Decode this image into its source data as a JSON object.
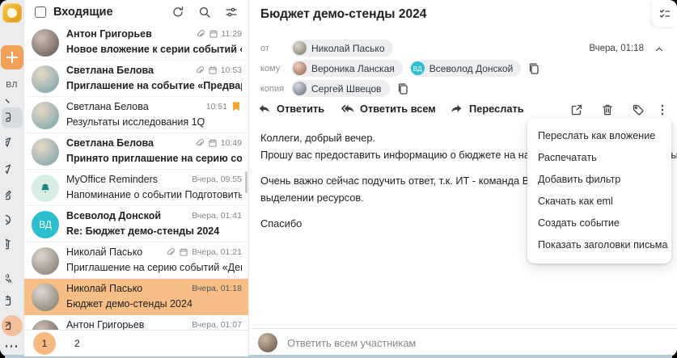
{
  "colors": {
    "accent_orange": "#f2a159",
    "selection_orange": "#f6be85",
    "flag_orange": "#f5a22d",
    "avatar_teal": "#2bbfce",
    "pagination_orange": "#f5b87e"
  },
  "rail": {
    "logo_icon": "myoffice-mail-logo",
    "profile_initials": "ВЛ",
    "folder_icons": [
      "inbox",
      "sent",
      "outbox",
      "drafts",
      "spam",
      "trash"
    ],
    "app_icons": [
      "contacts",
      "calendar",
      "mail",
      "more"
    ]
  },
  "list": {
    "header": {
      "title": "Входящие",
      "icons": [
        "refresh",
        "search",
        "filter"
      ]
    },
    "rows": [
      {
        "sender": "Антон Григорьев",
        "subject": "Новое вложение к серии событий «Аналити...",
        "time": "11:29",
        "unread": true,
        "attach": true
      },
      {
        "sender": "Светлана Белова",
        "subject": "Приглашение на событие «Предварительно...",
        "time": "10:53",
        "unread": true,
        "attach": true
      },
      {
        "sender": "Светлана Белова",
        "subject": "Результаты исследования 1Q",
        "time": "10:51",
        "unread": false,
        "flagged": true
      },
      {
        "sender": "Светлана Белова",
        "subject": "Принято приглашение на серию событий «...",
        "time": "10:49",
        "unread": true,
        "attach": true
      },
      {
        "sender": "MyOffice Reminders",
        "subject": "Напоминание о событии Подготовить отчет...",
        "time": "Вчера, 09:55",
        "unread": false,
        "bell": true
      },
      {
        "sender": "Всеволод Донской",
        "subject": "Re: Бюджет демо-стенды 2024",
        "time": "Вчера, 01:41",
        "unread": true,
        "initials": "ВД"
      },
      {
        "sender": "Николай Пасько",
        "subject": "Приглашение на серию событий «Демо стен...",
        "time": "Вчера, 01:21",
        "unread": false,
        "attach": true
      },
      {
        "sender": "Николай Пасько",
        "subject": "Бюджет демо-стенды 2024",
        "time": "Вчера, 01:18",
        "unread": false,
        "selected": true
      },
      {
        "sender": "Антон Григорьев",
        "subject": "",
        "time": "Вчера, 01:07",
        "unread": false
      }
    ],
    "pagination": {
      "page1": "1",
      "page2": "2",
      "current": "1"
    }
  },
  "detail": {
    "title": "Бюджет демо-стенды 2024",
    "tasks_icon": "checklist",
    "meta": {
      "from_label": "от",
      "from_name": "Николай Пасько",
      "to_label": "кому",
      "to1_name": "Вероника Ланская",
      "to2_name": "Всеволод Донской",
      "to2_initials": "ВД",
      "cc_label": "копия",
      "cc_name": "Сергей Швецов",
      "date": "Вчера, 01:18"
    },
    "toolbar": {
      "reply": "Ответить",
      "reply_all": "Ответить всем",
      "forward": "Переслать",
      "right_icons": [
        "open-in-new-window",
        "delete",
        "tag",
        "more-vertical"
      ]
    },
    "body": [
      "Коллеги, добрый вечер.",
      "Прошу вас предоставить информацию о бюджете на наши демонстрационные стенды.",
      "",
      "Очень важно сейчас подучить ответ, т.к. ИТ - команда Всеволода, уже спрашивает о",
      "выделении ресурсов.",
      "",
      "Спасибо"
    ],
    "quick_reply_placeholder": "Ответить всем участникам"
  },
  "context_menu": {
    "items": [
      "Переслать как вложение",
      "Распечатать",
      "Добавить фильтр",
      "Скачать как eml",
      "Создать событие",
      "Показать заголовки письма"
    ]
  }
}
